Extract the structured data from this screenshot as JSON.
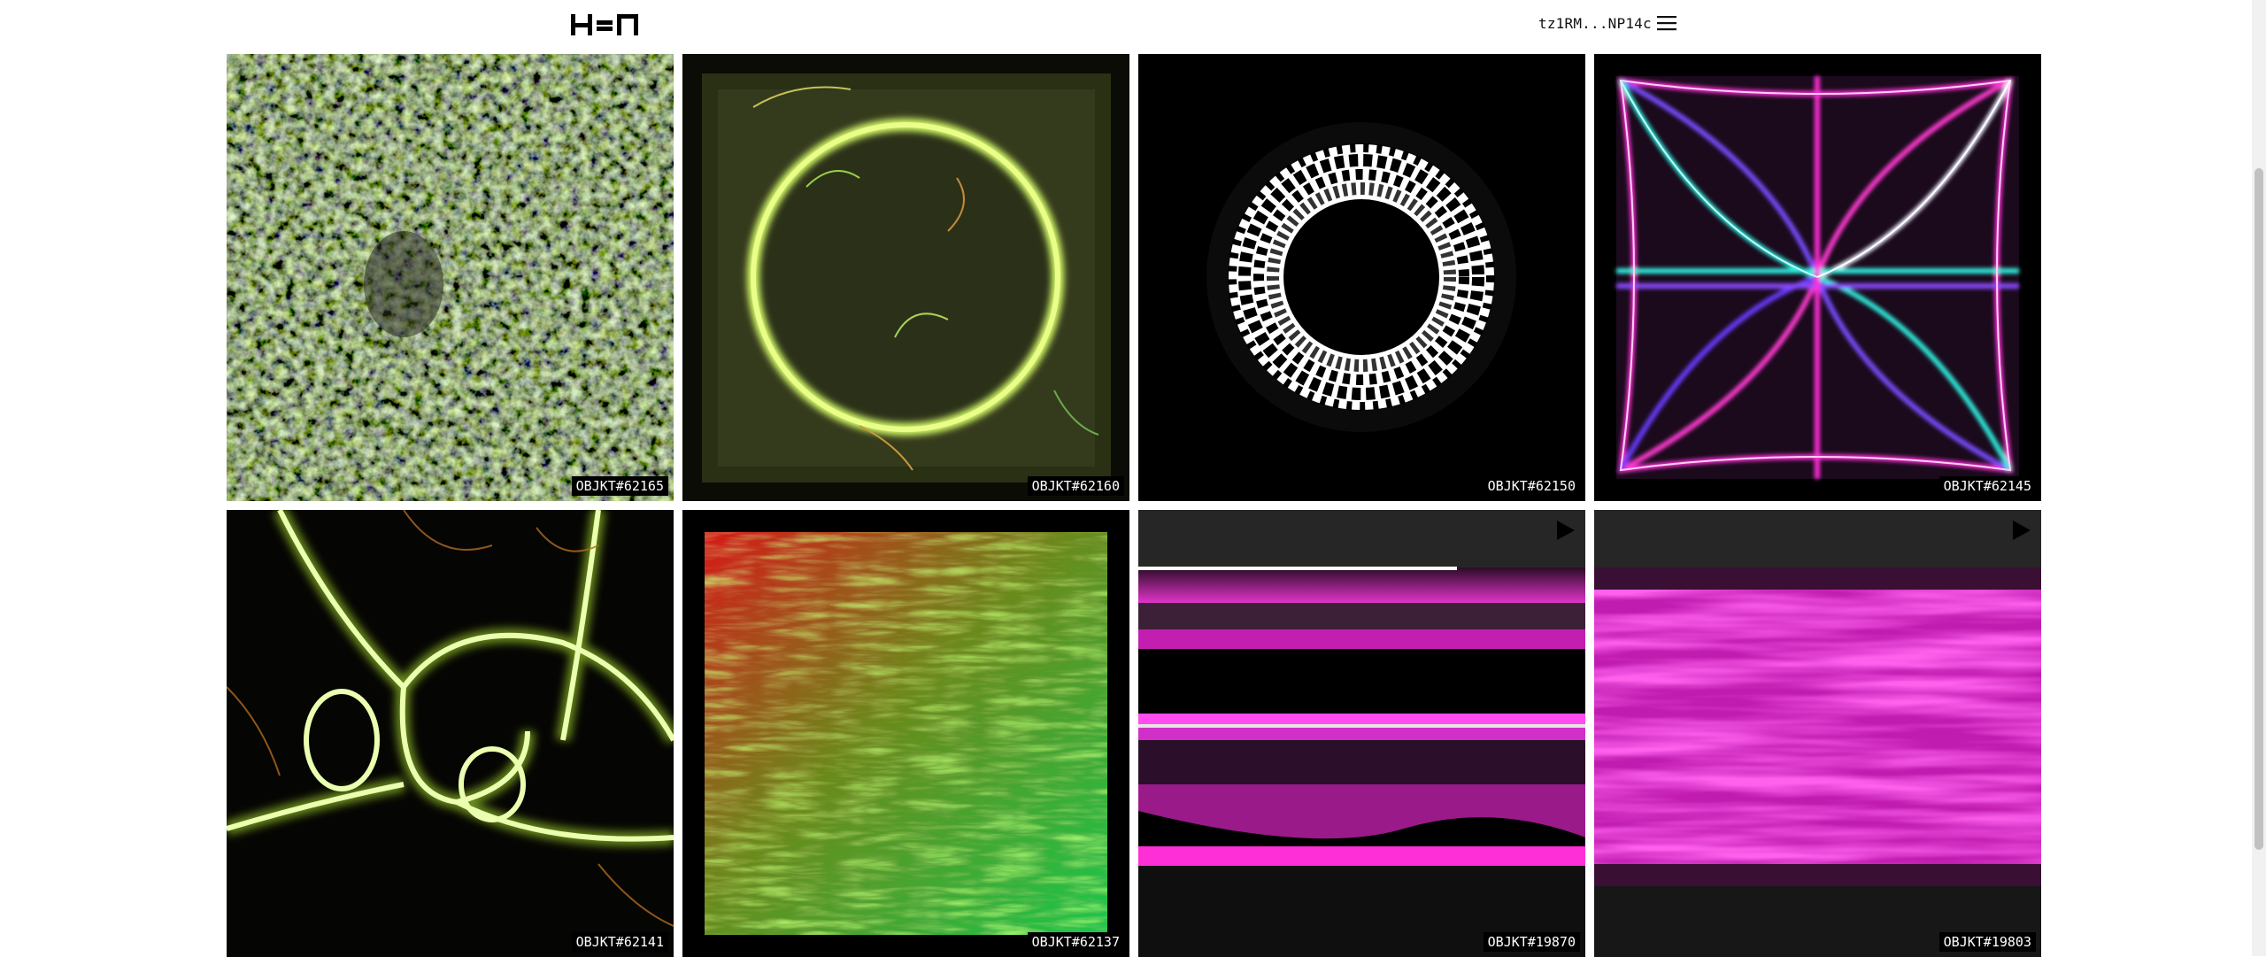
{
  "header": {
    "logo_icon": "hen-logo-icon",
    "wallet_address": "tz1RM...NP14c",
    "menu_icon": "hamburger-menu-icon"
  },
  "gallery": {
    "items": [
      {
        "label": "OBJKT#62165",
        "media": "image"
      },
      {
        "label": "OBJKT#62160",
        "media": "image"
      },
      {
        "label": "OBJKT#62150",
        "media": "image"
      },
      {
        "label": "OBJKT#62145",
        "media": "image"
      },
      {
        "label": "OBJKT#62141",
        "media": "image"
      },
      {
        "label": "OBJKT#62137",
        "media": "image"
      },
      {
        "label": "OBJKT#19870",
        "media": "video",
        "icon": "play-icon"
      },
      {
        "label": "OBJKT#19803",
        "media": "video",
        "icon": "play-icon"
      }
    ]
  },
  "colors": {
    "background": "#ffffff",
    "label_bg": "#000000",
    "label_text": "#ffffff",
    "magenta": "#ff1fd2",
    "lime": "#d8ff6a",
    "cyan": "#2ff0e0"
  }
}
